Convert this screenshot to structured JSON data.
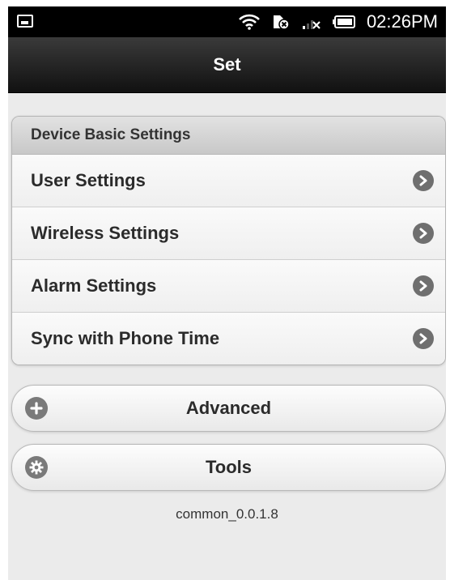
{
  "status_bar": {
    "time": "02:26PM",
    "icons": [
      "image-icon",
      "wifi-icon",
      "sim-error-icon",
      "signal-icon",
      "battery-icon"
    ]
  },
  "header": {
    "title": "Set"
  },
  "settings_group": {
    "title": "Device Basic Settings",
    "items": [
      {
        "label": "User Settings"
      },
      {
        "label": "Wireless Settings"
      },
      {
        "label": "Alarm Settings"
      },
      {
        "label": "Sync with Phone Time"
      }
    ]
  },
  "buttons": {
    "advanced_label": "Advanced",
    "tools_label": "Tools"
  },
  "footer": {
    "version": "common_0.0.1.8"
  }
}
